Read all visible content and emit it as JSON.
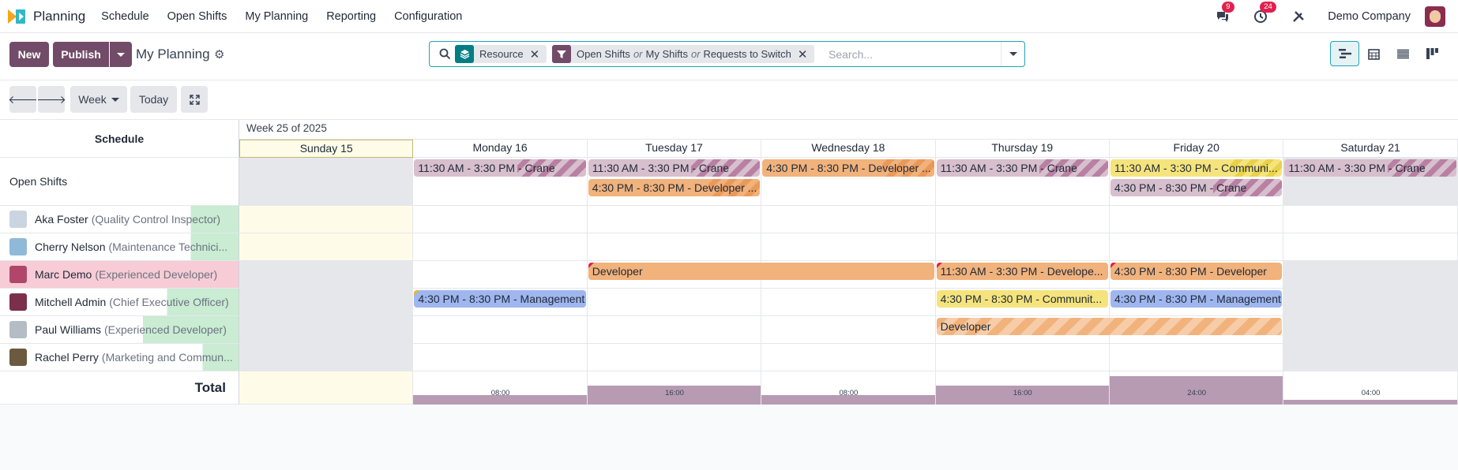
{
  "navbar": {
    "app_name": "Planning",
    "menu": [
      "Schedule",
      "Open Shifts",
      "My Planning",
      "Reporting",
      "Configuration"
    ],
    "messages_badge": "9",
    "activities_badge": "24",
    "company": "Demo Company"
  },
  "control": {
    "new_label": "New",
    "publish_label": "Publish",
    "title": "My Planning",
    "facets": {
      "group_label": "Resource",
      "filter_parts": [
        "Open Shifts",
        "or",
        "My Shifts",
        "or",
        "Requests to Switch"
      ]
    },
    "search_placeholder": "Search..."
  },
  "toolbar": {
    "scale_label": "Week",
    "today_label": "Today"
  },
  "gantt": {
    "period_label": "Week 25 of 2025",
    "row_header": "Schedule",
    "days": [
      "Sunday 15",
      "Monday 16",
      "Tuesday 17",
      "Wednesday 18",
      "Thursday 19",
      "Friday 20",
      "Saturday 21"
    ],
    "rows": [
      {
        "name": "Open Shifts",
        "job": ""
      },
      {
        "name": "Aka Foster",
        "job": "(Quality Control Inspector)"
      },
      {
        "name": "Cherry Nelson",
        "job": "(Maintenance Technici..."
      },
      {
        "name": "Marc Demo",
        "job": "(Experienced Developer)"
      },
      {
        "name": "Mitchell Admin",
        "job": "(Chief Executive Officer)"
      },
      {
        "name": "Paul Williams",
        "job": "(Experienced Developer)"
      },
      {
        "name": "Rachel Perry",
        "job": "(Marketing and Commun..."
      }
    ],
    "shifts": [
      {
        "row": 0,
        "day": 1,
        "span": 1,
        "lane": 0,
        "role": "crane",
        "label": "11:30 AM - 3:30 PM - Crane"
      },
      {
        "row": 0,
        "day": 2,
        "span": 1,
        "lane": 0,
        "role": "crane",
        "label": "11:30 AM - 3:30 PM - Crane"
      },
      {
        "row": 0,
        "day": 2,
        "span": 1,
        "lane": 1,
        "role": "dev-open",
        "label": "4:30 PM - 8:30 PM - Developer ..."
      },
      {
        "row": 0,
        "day": 3,
        "span": 1,
        "lane": 0,
        "role": "dev-open",
        "label": "4:30 PM - 8:30 PM - Developer ..."
      },
      {
        "row": 0,
        "day": 4,
        "span": 1,
        "lane": 0,
        "role": "crane",
        "label": "11:30 AM - 3:30 PM - Crane"
      },
      {
        "row": 0,
        "day": 5,
        "span": 1,
        "lane": 0,
        "role": "comm-open",
        "label": "11:30 AM - 3:30 PM - Communi..."
      },
      {
        "row": 0,
        "day": 5,
        "span": 1,
        "lane": 1,
        "role": "crane",
        "label": "4:30 PM - 8:30 PM - Crane"
      },
      {
        "row": 0,
        "day": 6,
        "span": 1,
        "lane": 0,
        "role": "crane",
        "label": "11:30 AM - 3:30 PM - Crane"
      },
      {
        "row": 3,
        "day": 2,
        "span": 2,
        "lane": 0,
        "role": "dev",
        "label": "Developer",
        "marker": "red"
      },
      {
        "row": 3,
        "day": 4,
        "span": 1,
        "lane": 0,
        "role": "dev",
        "label": "11:30 AM - 3:30 PM - Develope...",
        "marker": "red"
      },
      {
        "row": 3,
        "day": 5,
        "span": 1,
        "lane": 0,
        "role": "dev",
        "label": "4:30 PM - 8:30 PM - Developer",
        "marker": "red"
      },
      {
        "row": 4,
        "day": 1,
        "span": 1,
        "lane": 0,
        "role": "mgmt",
        "label": "4:30 PM - 8:30 PM - Management",
        "marker": "yellow"
      },
      {
        "row": 4,
        "day": 4,
        "span": 1,
        "lane": 0,
        "role": "comm",
        "label": "4:30 PM - 8:30 PM - Communit..."
      },
      {
        "row": 4,
        "day": 5,
        "span": 1,
        "lane": 0,
        "role": "mgmt",
        "label": "4:30 PM - 8:30 PM - Management"
      },
      {
        "row": 5,
        "day": 4,
        "span": 2,
        "lane": 0,
        "role": "devstripe",
        "label": "Developer"
      }
    ],
    "total_label": "Total",
    "totals": [
      {
        "day": 1,
        "label": "08:00",
        "hours": 8
      },
      {
        "day": 2,
        "label": "16:00",
        "hours": 16
      },
      {
        "day": 3,
        "label": "08:00",
        "hours": 8
      },
      {
        "day": 4,
        "label": "16:00",
        "hours": 16
      },
      {
        "day": 5,
        "label": "24:00",
        "hours": 24
      },
      {
        "day": 6,
        "label": "04:00",
        "hours": 4
      }
    ],
    "label_highlight_fraction": [
      0,
      0.2,
      0.2,
      0,
      0.3,
      0.4,
      0.15
    ]
  },
  "colors": {
    "brand": "#714b67",
    "accent": "#22a2b4",
    "today": "#fefce8",
    "unavailable": "#e5e7eb",
    "crane": "#c39ab2",
    "developer": "#f1b27c",
    "communication": "#f5e47d",
    "management": "#9fb6ef"
  }
}
